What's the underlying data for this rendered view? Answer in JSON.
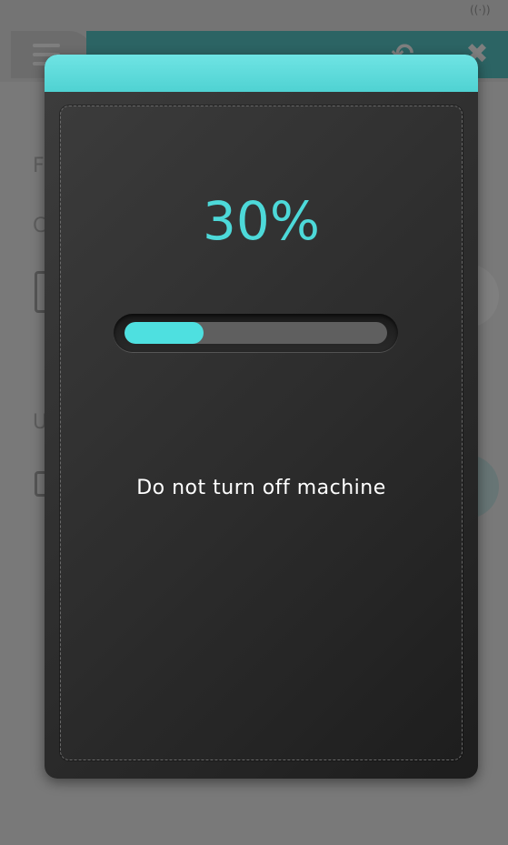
{
  "modal": {
    "percent_text": "30%",
    "progress_value": 0.3,
    "message": "Do not turn off machine",
    "accent_color": "#4ee0e0"
  },
  "background": {
    "icons": [
      "wifi-icon",
      "menu-icon",
      "undo-icon",
      "close-icon",
      "document-icon",
      "folder-icon"
    ],
    "partial_letters": [
      "F",
      "C",
      "U"
    ]
  }
}
